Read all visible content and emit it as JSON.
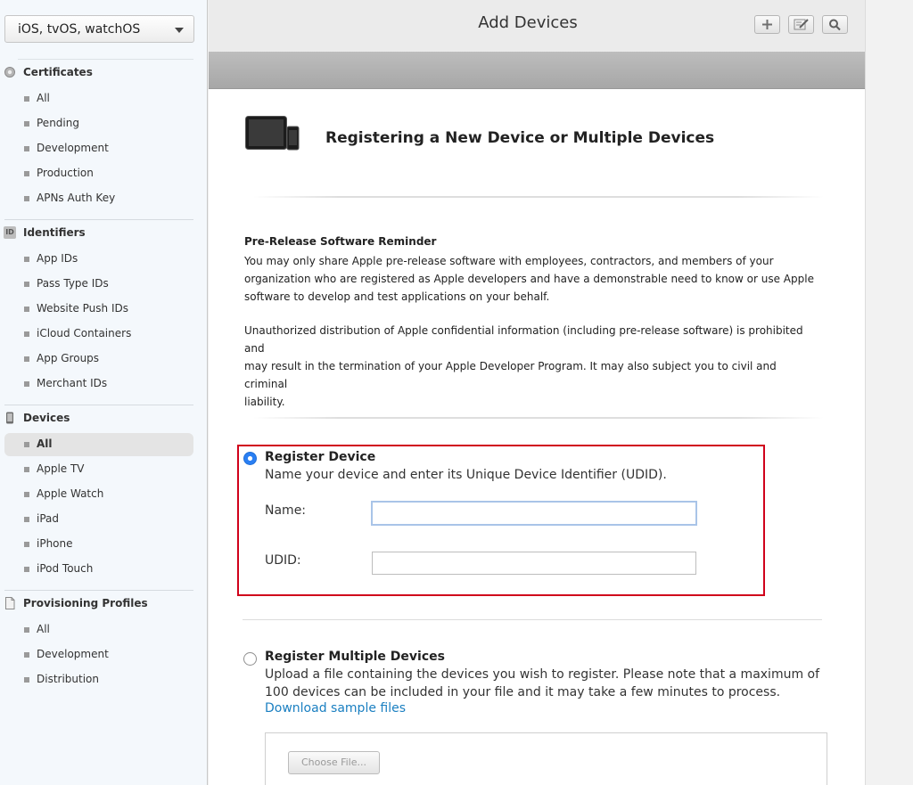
{
  "sidebar": {
    "platform": "iOS, tvOS, watchOS",
    "certificates": {
      "title": "Certificates",
      "items": [
        "All",
        "Pending",
        "Development",
        "Production",
        "APNs Auth Key"
      ]
    },
    "identifiers": {
      "title": "Identifiers",
      "badge": "ID",
      "items": [
        "App IDs",
        "Pass Type IDs",
        "Website Push IDs",
        "iCloud Containers",
        "App Groups",
        "Merchant IDs"
      ]
    },
    "devices": {
      "title": "Devices",
      "selected": "All",
      "items": [
        "All",
        "Apple TV",
        "Apple Watch",
        "iPad",
        "iPhone",
        "iPod Touch"
      ]
    },
    "profiles": {
      "title": "Provisioning Profiles",
      "items": [
        "All",
        "Development",
        "Distribution"
      ]
    }
  },
  "header": {
    "title": "Add Devices",
    "toolbar": [
      "plus-icon",
      "edit-icon",
      "search-icon"
    ]
  },
  "main": {
    "page_title": "Registering a New Device or Multiple Devices",
    "reminder": {
      "title": "Pre-Release Software Reminder",
      "p1_lines": [
        "You may only share Apple pre-release software with employees, contractors, and members of your",
        "organization who are registered as Apple developers and have a demonstrable need to know or use Apple",
        "software to develop and test applications on your behalf."
      ],
      "p2_lines": [
        "Unauthorized distribution of Apple confidential information (including pre-release software) is prohibited and",
        "may result in the termination of your Apple Developer Program. It may also subject you to civil and criminal",
        "liability."
      ]
    },
    "register_device": {
      "title": "Register Device",
      "desc": "Name your device and enter its Unique Device Identifier (UDID).",
      "name_label": "Name:",
      "udid_label": "UDID:",
      "name_value": "",
      "udid_value": "",
      "selected": true,
      "highlight_color": "#d0021b"
    },
    "register_multiple": {
      "title": "Register Multiple Devices",
      "desc_lines": [
        "Upload a file containing the devices you wish to register. Please note that a maximum of",
        "100 devices can be included in your file and it may take a few minutes to process."
      ],
      "link": "Download sample files",
      "choose_button": "Choose File...",
      "selected": false
    }
  },
  "colors": {
    "accent": "#2a7ff3",
    "link": "#1a7fc1"
  }
}
